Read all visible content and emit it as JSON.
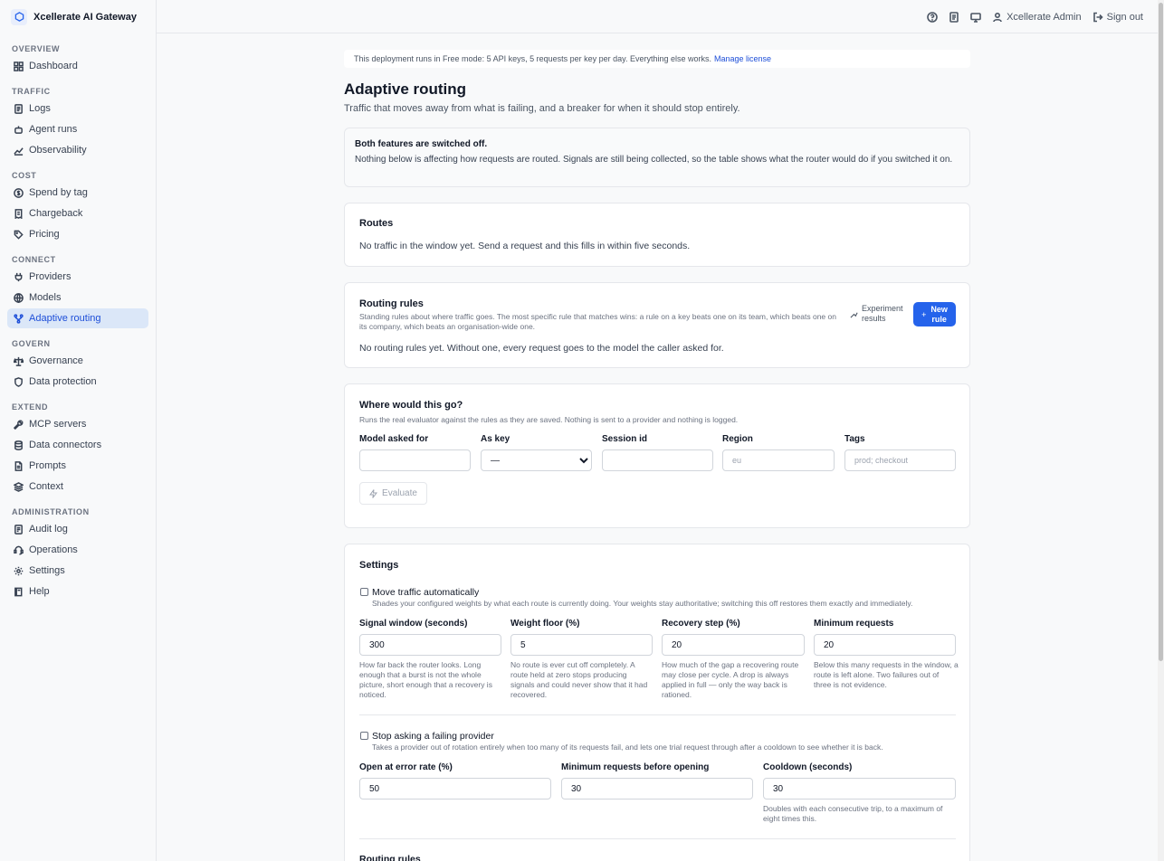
{
  "app": {
    "name": "Xcellerate AI Gateway"
  },
  "sidebar": {
    "sections": [
      {
        "title": "OVERVIEW",
        "items": [
          {
            "label": "Dashboard",
            "icon": "dashboard-icon"
          }
        ]
      },
      {
        "title": "TRAFFIC",
        "items": [
          {
            "label": "Logs",
            "icon": "logs-icon"
          },
          {
            "label": "Agent runs",
            "icon": "agent-icon"
          },
          {
            "label": "Observability",
            "icon": "chart-icon"
          }
        ]
      },
      {
        "title": "COST",
        "items": [
          {
            "label": "Spend by tag",
            "icon": "dollar-icon"
          },
          {
            "label": "Chargeback",
            "icon": "receipt-icon"
          },
          {
            "label": "Pricing",
            "icon": "tag-icon"
          }
        ]
      },
      {
        "title": "CONNECT",
        "items": [
          {
            "label": "Providers",
            "icon": "plug-icon"
          },
          {
            "label": "Models",
            "icon": "globe-icon"
          },
          {
            "label": "Adaptive routing",
            "icon": "route-icon",
            "active": true
          }
        ]
      },
      {
        "title": "GOVERN",
        "items": [
          {
            "label": "Governance",
            "icon": "scale-icon"
          },
          {
            "label": "Data protection",
            "icon": "shield-icon"
          }
        ]
      },
      {
        "title": "EXTEND",
        "items": [
          {
            "label": "MCP servers",
            "icon": "wrench-icon"
          },
          {
            "label": "Data connectors",
            "icon": "database-icon"
          },
          {
            "label": "Prompts",
            "icon": "file-icon"
          },
          {
            "label": "Context",
            "icon": "layers-icon"
          }
        ]
      },
      {
        "title": "ADMINISTRATION",
        "items": [
          {
            "label": "Audit log",
            "icon": "audit-icon"
          },
          {
            "label": "Operations",
            "icon": "ops-icon"
          },
          {
            "label": "Settings",
            "icon": "gear-icon"
          },
          {
            "label": "Help",
            "icon": "book-icon"
          }
        ]
      }
    ]
  },
  "topbar": {
    "user": "Xcellerate Admin",
    "signout": "Sign out"
  },
  "banner": {
    "text": "This deployment runs in Free mode: 5 API keys, 5 requests per key per day. Everything else works.",
    "link": "Manage license"
  },
  "page": {
    "title": "Adaptive routing",
    "subtitle": "Traffic that moves away from what is failing, and a breaker for when it should stop entirely."
  },
  "notice": {
    "title": "Both features are switched off.",
    "body": "Nothing below is affecting how requests are routed. Signals are still being collected, so the table shows what the router would do if you switched it on."
  },
  "routes": {
    "title": "Routes",
    "empty": "No traffic in the window yet. Send a request and this fills in within five seconds."
  },
  "routing_rules": {
    "title": "Routing rules",
    "description": "Standing rules about where traffic goes. The most specific rule that matches wins: a rule on a key beats one on its team, which beats one on its company, which beats an organisation-wide one.",
    "experiment_label_1": "Experiment",
    "experiment_label_2": "results",
    "new_rule_plus": "+",
    "new_rule_label_1": "New",
    "new_rule_label_2": "rule",
    "empty": "No routing rules yet. Without one, every request goes to the model the caller asked for."
  },
  "evaluator": {
    "title": "Where would this go?",
    "description": "Runs the real evaluator against the rules as they are saved. Nothing is sent to a provider and nothing is logged.",
    "fields": {
      "model": {
        "label": "Model asked for",
        "value": "",
        "placeholder": ""
      },
      "key": {
        "label": "As key",
        "selected": "—"
      },
      "session": {
        "label": "Session id",
        "value": "",
        "placeholder": ""
      },
      "region": {
        "label": "Region",
        "placeholder": "eu"
      },
      "tags": {
        "label": "Tags",
        "placeholder": "prod; checkout"
      }
    },
    "evaluate_label": "Evaluate"
  },
  "settings": {
    "title": "Settings",
    "move_traffic": {
      "label": "Move traffic automatically",
      "checked": false,
      "description": "Shades your configured weights by what each route is currently doing. Your weights stay authoritative; switching this off restores them exactly and immediately.",
      "fields": [
        {
          "label": "Signal window (seconds)",
          "value": "300",
          "help": "How far back the router looks. Long enough that a burst is not the whole picture, short enough that a recovery is noticed."
        },
        {
          "label": "Weight floor (%)",
          "value": "5",
          "help": "No route is ever cut off completely. A route held at zero stops producing signals and could never show that it had recovered."
        },
        {
          "label": "Recovery step (%)",
          "value": "20",
          "help": "How much of the gap a recovering route may close per cycle. A drop is always applied in full — only the way back is rationed."
        },
        {
          "label": "Minimum requests",
          "value": "20",
          "help": "Below this many requests in the window, a route is left alone. Two failures out of three is not evidence."
        }
      ]
    },
    "breaker": {
      "label": "Stop asking a failing provider",
      "checked": false,
      "description": "Takes a provider out of rotation entirely when too many of its requests fail, and lets one trial request through after a cooldown to see whether it is back.",
      "fields": [
        {
          "label": "Open at error rate (%)",
          "value": "50",
          "help": ""
        },
        {
          "label": "Minimum requests before opening",
          "value": "30",
          "help": ""
        },
        {
          "label": "Cooldown (seconds)",
          "value": "30",
          "help": "Doubles with each consecutive trip, to a maximum of eight times this."
        }
      ]
    },
    "next_heading": "Routing rules"
  },
  "colors": {
    "accent": "#2563eb",
    "active_bg": "#dbe7f8",
    "page_bg": "#f8f9fa"
  }
}
